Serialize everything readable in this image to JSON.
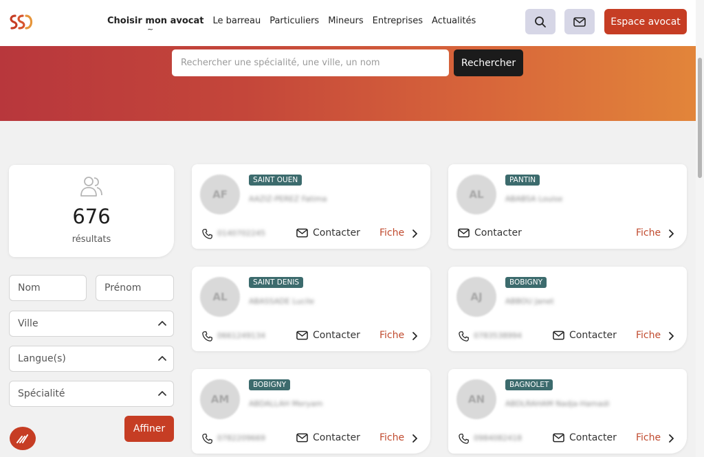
{
  "header": {
    "nav": [
      {
        "label": "Choisir mon avocat",
        "active": true
      },
      {
        "label": "Le barreau",
        "active": false
      },
      {
        "label": "Particuliers",
        "active": false
      },
      {
        "label": "Mineurs",
        "active": false
      },
      {
        "label": "Entreprises",
        "active": false
      },
      {
        "label": "Actualités",
        "active": false
      }
    ],
    "nav_tilde": "~",
    "espace_label": "Espace avocat"
  },
  "search": {
    "placeholder": "Rechercher une spécialité, une ville, un nom",
    "button_label": "Rechercher"
  },
  "results": {
    "count": "676",
    "label": "résultats"
  },
  "filters": {
    "nom": "Nom",
    "prenom": "Prénom",
    "ville": "Ville",
    "langues": "Langue(s)",
    "specialite": "Spécialité",
    "affiner": "Affiner"
  },
  "cards": [
    {
      "initials": "AF",
      "tag": "SAINT OUEN",
      "name": "AAZIZ-PEREZ Fatima",
      "phone": "0140702245",
      "contacter": "Contacter",
      "fiche": "Fiche"
    },
    {
      "initials": "AL",
      "tag": "PANTIN",
      "name": "ABABSA Louise",
      "phone": "",
      "contacter": "Contacter",
      "fiche": "Fiche"
    },
    {
      "initials": "AL",
      "tag": "SAINT DENIS",
      "name": "ABASSADE Lucile",
      "phone": "0661249134",
      "contacter": "Contacter",
      "fiche": "Fiche"
    },
    {
      "initials": "AJ",
      "tag": "BOBIGNY",
      "name": "ABBOU Janet",
      "phone": "0783538994",
      "contacter": "Contacter",
      "fiche": "Fiche"
    },
    {
      "initials": "AM",
      "tag": "BOBIGNY",
      "name": "ABDALLAH Meryam",
      "phone": "0782209669",
      "contacter": "Contacter",
      "fiche": "Fiche"
    },
    {
      "initials": "AN",
      "tag": "BAGNOLET",
      "name": "ABDLRAHAM Nadja-Hamadi",
      "phone": "0984082418",
      "contacter": "Contacter",
      "fiche": "Fiche"
    }
  ],
  "colors": {
    "accent": "#c63d24",
    "tag": "#3c6b6d",
    "fiche": "#c04a2e",
    "dark_button": "#1b1b1b"
  }
}
